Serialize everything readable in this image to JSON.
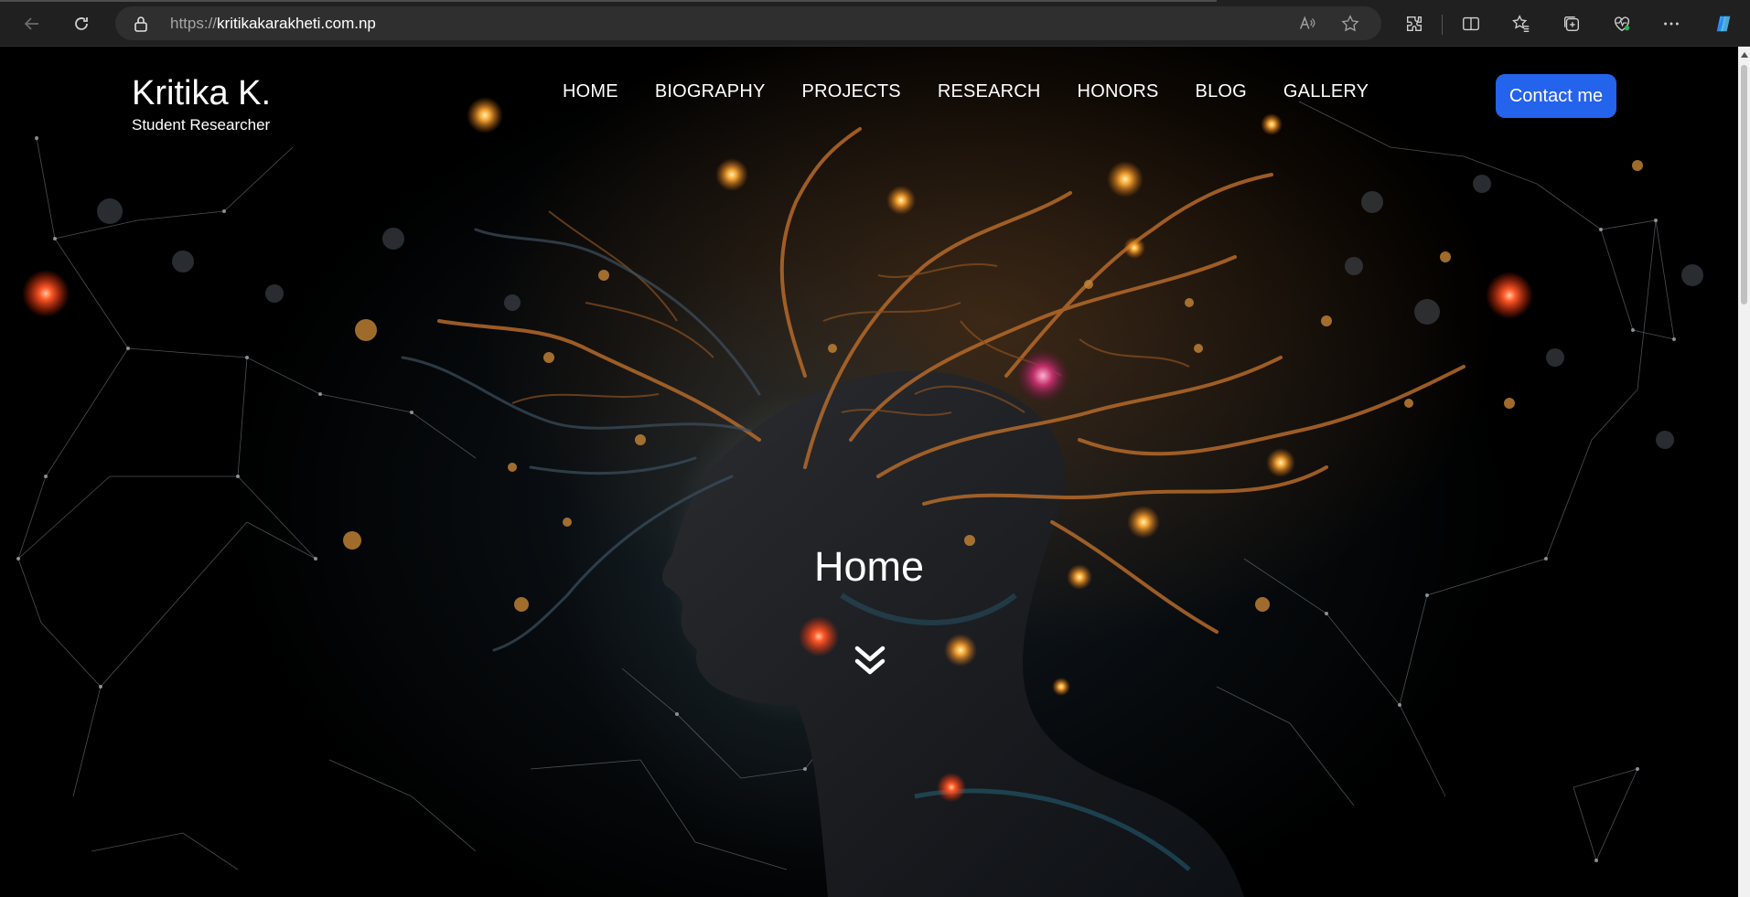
{
  "browser": {
    "url_protocol": "https://",
    "url_host": "kritikakarakheti.com.np",
    "icons": [
      "back-icon",
      "refresh-icon",
      "lock-icon",
      "read-aloud-icon",
      "favorite-star-icon",
      "extensions-icon",
      "split-screen-icon",
      "favorites-icon",
      "collections-icon",
      "browser-essentials-icon",
      "more-icon",
      "copilot-icon"
    ]
  },
  "site": {
    "brand_name": "Kritika K.",
    "brand_tagline": "Student Researcher",
    "nav": [
      "HOME",
      "BIOGRAPHY",
      "PROJECTS",
      "RESEARCH",
      "HONORS",
      "BLOG",
      "GALLERY"
    ],
    "contact_label": "Contact me",
    "page_title": "Home"
  },
  "colors": {
    "accent": "#2463eb",
    "chrome_bg": "#202020",
    "urlbar_bg": "#2f2f2f"
  }
}
